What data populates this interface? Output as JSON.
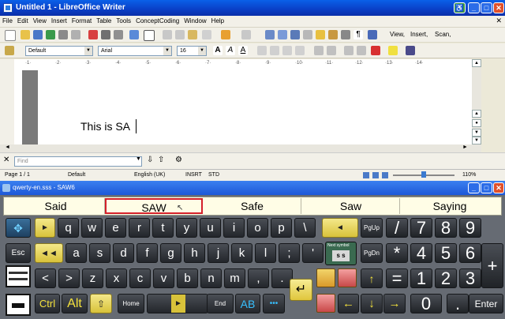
{
  "writer": {
    "title": "Untitled 1 - LibreOffice Writer",
    "menu": [
      "File",
      "Edit",
      "View",
      "Insert",
      "Format",
      "Table",
      "Tools",
      "ConceptCoding",
      "Window",
      "Help"
    ],
    "toolbar_texts": {
      "view": "View,",
      "insert": "Insert,",
      "scan": "Scan,"
    },
    "style": "Default",
    "font": "Arial",
    "size": "16",
    "document_text": "This is SA",
    "find_placeholder": "Find",
    "status": {
      "page": "Page 1 / 1",
      "style": "Default",
      "language": "English (UK)",
      "mode": "INSRT",
      "sel": "STD",
      "zoom": "110%"
    }
  },
  "keyboard": {
    "title": "qwerty-en.sss - SAW6",
    "predictions": [
      "Said",
      "SAW",
      "Safe",
      "Saw",
      "Saying"
    ],
    "row1": [
      "q",
      "w",
      "e",
      "r",
      "t",
      "y",
      "u",
      "i",
      "o",
      "p",
      "\\"
    ],
    "row2": [
      "a",
      "s",
      "d",
      "f",
      "g",
      "h",
      "j",
      "k",
      "l",
      ";",
      "'"
    ],
    "row3": [
      "<",
      ">",
      "z",
      "x",
      "c",
      "v",
      "b",
      "n",
      "m",
      ",",
      "."
    ],
    "labels": {
      "esc": "Esc",
      "ctrl": "Ctrl",
      "alt": "Alt",
      "home": "Home",
      "end": "End",
      "ab": "AB",
      "dots": "•••",
      "pgup": "PgUp",
      "pgdn": "PgDn",
      "enter": "Enter",
      "ss": "s s",
      "next_symbol": "Next symbol"
    },
    "numpad": {
      "row1": [
        "/",
        "7",
        "8",
        "9"
      ],
      "row2": [
        "*",
        "4",
        "5",
        "6"
      ],
      "row3": [
        "=",
        "1",
        "2",
        "3"
      ],
      "zero": "0",
      "plus": "+"
    }
  },
  "colors": {
    "title_blue": "#0a3fc6",
    "prediction_highlight": "#d4202a",
    "key_dark": "#2b2e33",
    "arrow_yellow": "#f4e23c"
  }
}
